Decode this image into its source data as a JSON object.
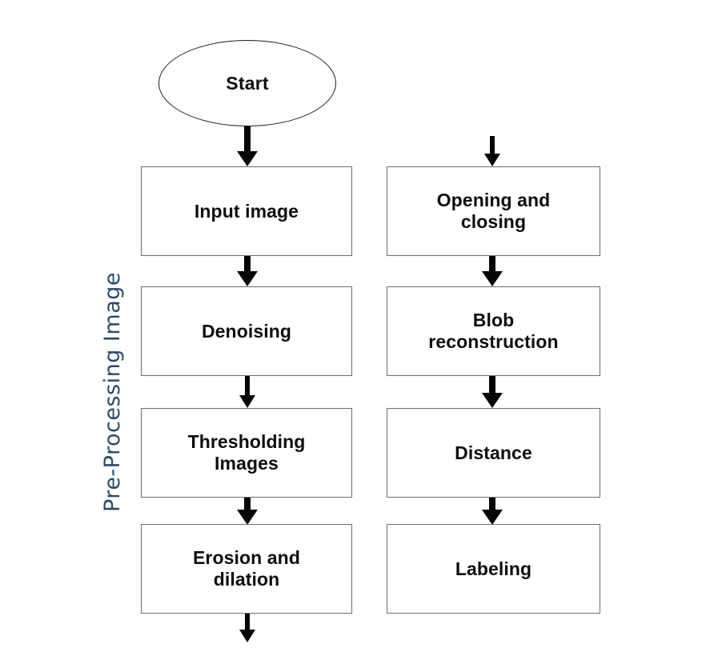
{
  "diagram": {
    "title": "Pre-Processing Image",
    "side_label": "Pre-Processing Image",
    "background_color": "#ffffff",
    "accent_color": "#2c4a66",
    "box_border_color": "#6e6e72",
    "arrow_color": "#050505",
    "text_color": "#0d0d12"
  },
  "start": {
    "label": "Start",
    "shape": "ellipse"
  },
  "columns": {
    "left": {
      "name": "pre-processing-column",
      "steps": [
        {
          "id": "input-image",
          "label": "Input image"
        },
        {
          "id": "denoising",
          "label": "Denoising"
        },
        {
          "id": "thresholding-images",
          "label": "Thresholding\nImages"
        },
        {
          "id": "erosion-dilation",
          "label": "Erosion and\ndilation"
        }
      ]
    },
    "right": {
      "name": "segmentation-column",
      "steps": [
        {
          "id": "opening-closing",
          "label": "Opening and\nclosing"
        },
        {
          "id": "blob-reconstruction",
          "label": "Blob\nreconstruction"
        },
        {
          "id": "distance",
          "label": "Distance"
        },
        {
          "id": "labeling",
          "label": "Labeling"
        }
      ]
    }
  },
  "connectors": [
    {
      "id": "start-to-input-image",
      "from": "start",
      "to": "input-image",
      "type": "arrow-down"
    },
    {
      "id": "input-image-to-denoising",
      "from": "input-image",
      "to": "denoising",
      "type": "arrow-down"
    },
    {
      "id": "denoising-to-thresholding",
      "from": "denoising",
      "to": "thresholding-images",
      "type": "arrow-down"
    },
    {
      "id": "thresholding-to-erosion",
      "from": "thresholding-images",
      "to": "erosion-dilation",
      "type": "arrow-down"
    },
    {
      "id": "erosion-to-offpage",
      "from": "erosion-dilation",
      "to": "",
      "type": "arrow-down"
    },
    {
      "id": "offpage-to-opening-closing",
      "from": "",
      "to": "opening-closing",
      "type": "arrow-down"
    },
    {
      "id": "opening-closing-to-blob",
      "from": "opening-closing",
      "to": "blob-reconstruction",
      "type": "arrow-down"
    },
    {
      "id": "blob-to-distance",
      "from": "blob-reconstruction",
      "to": "distance",
      "type": "arrow-down"
    },
    {
      "id": "distance-to-labeling",
      "from": "distance",
      "to": "labeling",
      "type": "arrow-down"
    }
  ]
}
